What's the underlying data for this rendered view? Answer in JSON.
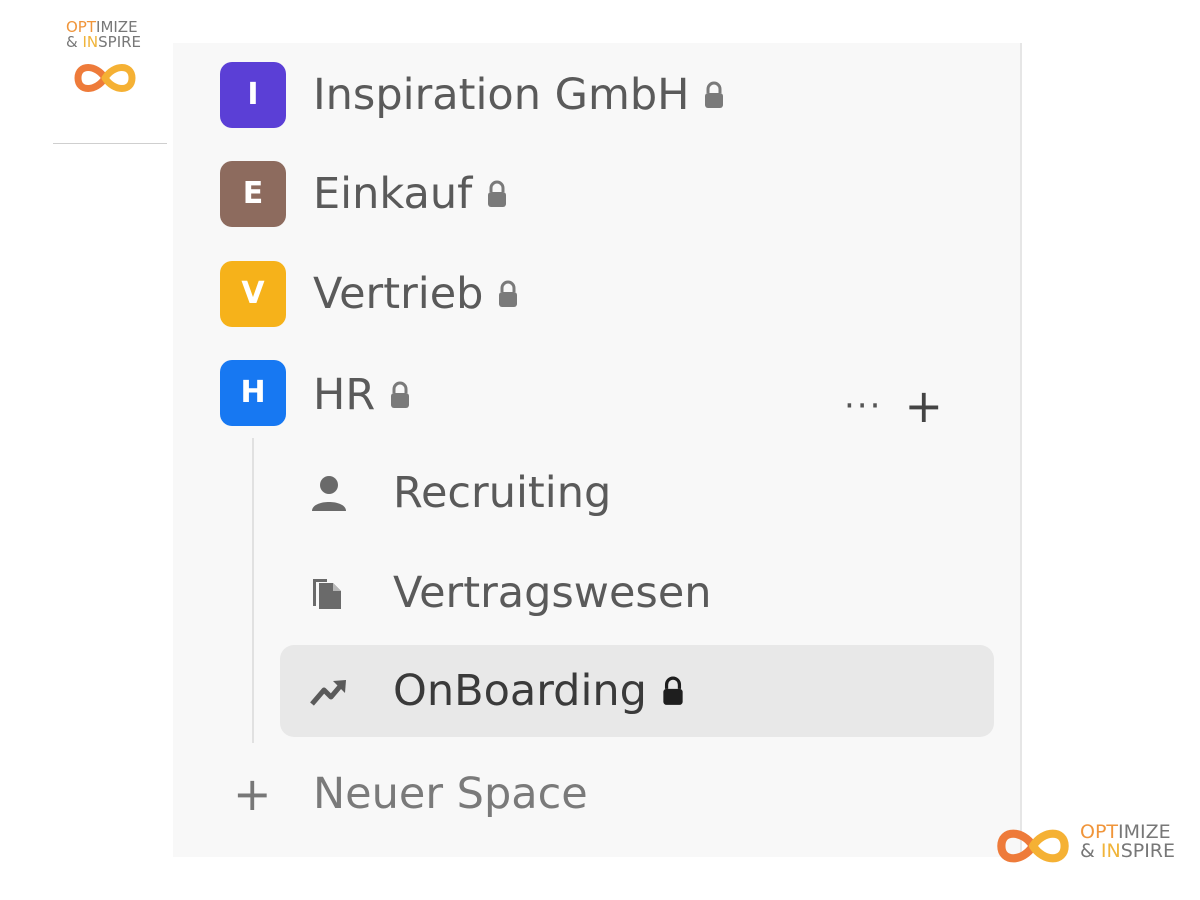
{
  "logo": {
    "line1_highlight": "OPT",
    "line1_rest": "IMIZE",
    "line2_prefix": "& ",
    "line2_highlight": "IN",
    "line2_rest": "SPIRE"
  },
  "spaces": [
    {
      "initial": "I",
      "label": "Inspiration GmbH",
      "color": "#5b3fd6",
      "locked": true
    },
    {
      "initial": "E",
      "label": "Einkauf",
      "color": "#8d6b5e",
      "locked": true
    },
    {
      "initial": "V",
      "label": "Vertrieb",
      "color": "#f6b21a",
      "locked": true
    },
    {
      "initial": "H",
      "label": "HR",
      "color": "#1778f2",
      "locked": true
    }
  ],
  "hr_children": [
    {
      "icon": "person-icon",
      "label": "Recruiting"
    },
    {
      "icon": "documents-icon",
      "label": "Vertragswesen"
    },
    {
      "icon": "trend-icon",
      "label": "OnBoarding",
      "locked": true,
      "selected": true
    }
  ],
  "hr_actions": {
    "more": "···",
    "add": "+"
  },
  "new_space": {
    "plus": "+",
    "label": "Neuer Space"
  }
}
